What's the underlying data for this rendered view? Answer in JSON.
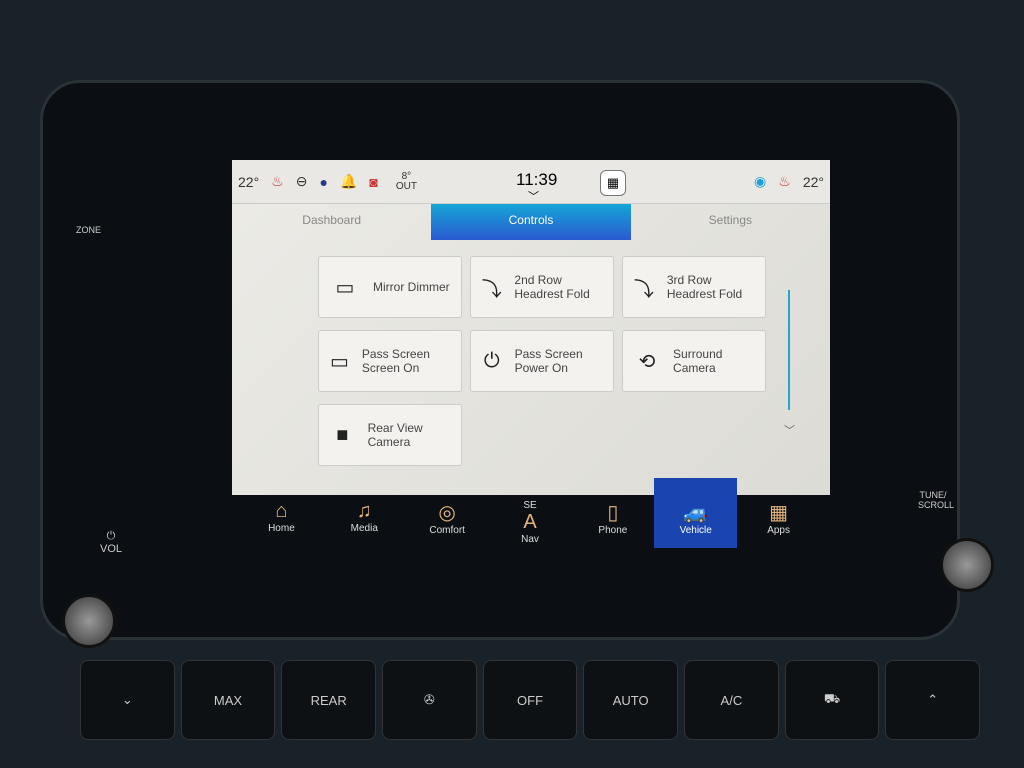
{
  "status": {
    "temp_left": "22°",
    "outside_temp": "8°",
    "outside_label": "OUT",
    "time": "11:39",
    "temp_right": "22°",
    "icons": [
      "seat-heat-icon",
      "steering-heat-icon",
      "profile-icon",
      "bell-icon",
      "wifi-icon",
      "quick-controls-icon",
      "alexa-icon",
      "seat-vent-icon"
    ]
  },
  "tabs": [
    {
      "label": "Dashboard"
    },
    {
      "label": "Controls",
      "active": true
    },
    {
      "label": "Settings"
    }
  ],
  "cards": [
    {
      "label": "Mirror Dimmer",
      "icon": "mirror-dimmer-icon",
      "glyph": "▭"
    },
    {
      "label": "2nd Row Headrest Fold",
      "icon": "headrest-fold-icon",
      "glyph": "⤵"
    },
    {
      "label": "3rd Row Headrest Fold",
      "icon": "headrest-fold-icon",
      "glyph": "⤵"
    },
    {
      "label": "Pass Screen Screen On",
      "icon": "screen-icon",
      "glyph": "▭"
    },
    {
      "label": "Pass Screen Power On",
      "icon": "power-icon",
      "glyph": "⏻"
    },
    {
      "label": "Surround Camera",
      "icon": "surround-camera-icon",
      "glyph": "⟲"
    },
    {
      "label": "Rear View Camera",
      "icon": "camera-icon",
      "glyph": "■"
    }
  ],
  "nav": [
    {
      "label": "Home",
      "glyph": "⌂"
    },
    {
      "label": "Media",
      "glyph": "♫"
    },
    {
      "label": "Comfort",
      "glyph": "◎"
    },
    {
      "label": "Nav",
      "heading": "SE",
      "glyph": "A"
    },
    {
      "label": "Phone",
      "glyph": "▯"
    },
    {
      "label": "Vehicle",
      "glyph": "🚙",
      "active": true
    },
    {
      "label": "Apps",
      "glyph": "▦"
    }
  ],
  "side": {
    "left_zone": "ZONE",
    "vol": "VOL",
    "tune": "TUNE/ SCROLL"
  },
  "hardware": [
    "⌄",
    "MAX",
    "REAR",
    "fan-icon",
    "OFF",
    "AUTO",
    "A/C",
    "recirc-icon",
    "⌃"
  ],
  "colors": {
    "accent": "#1a44b0",
    "tab_active": "#15a6d6"
  }
}
